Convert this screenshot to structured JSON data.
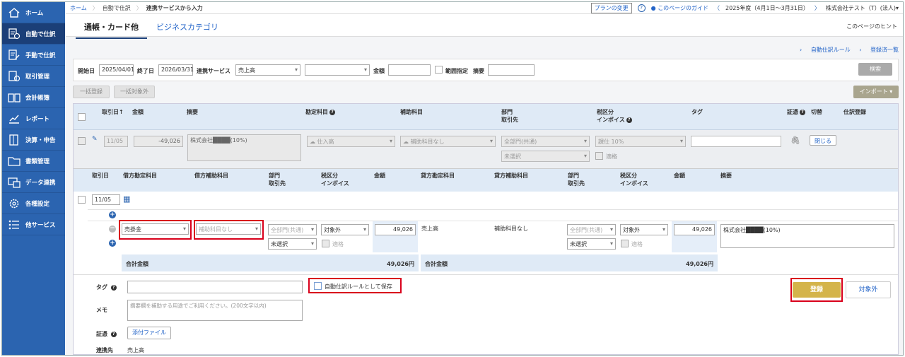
{
  "sidebar": {
    "items": [
      {
        "label": "ホーム",
        "icon": "home-icon"
      },
      {
        "label": "自動で仕訳",
        "icon": "auto-journal-icon"
      },
      {
        "label": "手動で仕訳",
        "icon": "manual-journal-icon"
      },
      {
        "label": "取引管理",
        "icon": "transactions-icon"
      },
      {
        "label": "会計帳簿",
        "icon": "ledger-icon"
      },
      {
        "label": "レポート",
        "icon": "report-icon"
      },
      {
        "label": "決算・申告",
        "icon": "settlement-icon"
      },
      {
        "label": "書類管理",
        "icon": "folder-icon"
      },
      {
        "label": "データ連携",
        "icon": "data-link-icon"
      },
      {
        "label": "各種設定",
        "icon": "gear-icon"
      },
      {
        "label": "他サービス",
        "icon": "list-icon"
      }
    ]
  },
  "breadcrumb": {
    "home": "ホーム",
    "level1": "自動で仕訳",
    "level2": "連携サービスから入力"
  },
  "topbar": {
    "plan_change": "プランの変更",
    "guide": "このページのガイド",
    "fiscal_year": "2025年度（4月1日〜3月31日）",
    "company": "株式会社テスト（T）(法人)▾"
  },
  "tabs": {
    "active": "通帳・カード他",
    "other": "ビジネスカテゴリ"
  },
  "hint": "このページのヒント",
  "rule_links": {
    "auto_rule": "自動仕訳ルール",
    "registered": "登録済一覧"
  },
  "filter": {
    "start_label": "開始日",
    "start_value": "2025/04/01",
    "end_label": "終了日",
    "end_value": "2026/03/31",
    "service_label": "連携サービス",
    "service_value": "売上高",
    "amount_label": "金額",
    "range_label": "範囲指定",
    "memo_label": "摘要",
    "search_button": "検索"
  },
  "actions": {
    "bulk_register": "一括登録",
    "bulk_exclude": "一括対象外",
    "import": "インポート ▾"
  },
  "table_header": {
    "date": "取引日↑",
    "amount": "金額",
    "summary": "摘要",
    "account": "勘定科目",
    "sub_account": "補助科目",
    "dept": "部門",
    "partner": "取引先",
    "tax": "税区分",
    "invoice": "インボイス",
    "tag": "タグ",
    "evidence": "証憑",
    "switch": "切替",
    "register": "仕訳登録"
  },
  "row": {
    "date": "11/05",
    "amount": "-49,026",
    "summary": "株式会社████(10%)",
    "account": "仕入高",
    "sub_account": "補助科目なし",
    "dept": "全部門(共通)",
    "partner": "未選択",
    "tax": "課仕 10%",
    "qualified": "適格",
    "close": "閉じる"
  },
  "journal_header": {
    "date": "取引日",
    "debit_account": "借方勘定科目",
    "debit_sub": "借方補助科目",
    "dept": "部門",
    "partner": "取引先",
    "tax": "税区分",
    "invoice": "インボイス",
    "amount": "金額",
    "credit_account": "貸方勘定科目",
    "credit_sub": "貸方補助科目",
    "summary": "摘要"
  },
  "journal": {
    "date": "11/05",
    "debit_account": "売掛金",
    "debit_sub": "補助科目なし",
    "debit_dept": "全部門(共通)",
    "debit_partner": "未選択",
    "debit_tax": "対象外",
    "debit_qualified": "適格",
    "debit_amount": "49,026",
    "credit_account": "売上高",
    "credit_sub": "補助科目なし",
    "credit_dept": "全部門(共通)",
    "credit_partner": "未選択",
    "credit_tax": "対象外",
    "credit_qualified": "適格",
    "credit_amount": "49,026",
    "summary": "株式会社████(10%)",
    "total_label": "合計金額",
    "debit_total": "49,026円",
    "credit_total": "49,026円"
  },
  "bottom": {
    "tag_label": "タグ",
    "memo_label": "メモ",
    "memo_placeholder": "摘要欄を補助する用途でご利用ください。(200文字以内)",
    "evidence_label": "証憑",
    "attach_button": "添付ファイル",
    "source_label": "連携先",
    "source_value": "売上高",
    "save_rule_label": "自動仕訳ルールとして保存",
    "register_button": "登録",
    "exclude_button": "対象外"
  },
  "colors": {
    "sidebar": "#2b64b0",
    "accent": "#2364c8",
    "highlight": "#d9001b",
    "register": "#d4b44a"
  }
}
